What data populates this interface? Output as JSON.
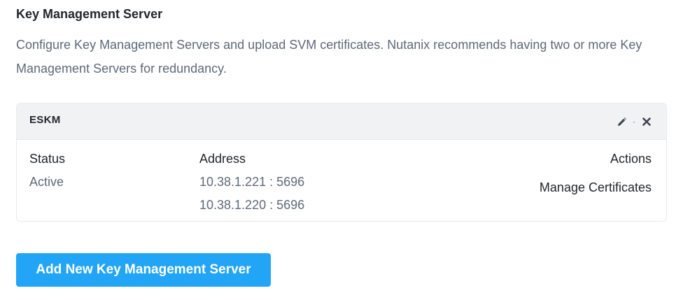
{
  "section": {
    "title": "Key Management Server",
    "description": "Configure Key Management Servers and upload SVM certificates. Nutanix recommends having two or more Key Management Servers for redundancy."
  },
  "server_card": {
    "name": "ESKM",
    "header_icons": [
      "pencil-icon",
      "close-icon"
    ],
    "separator": "·",
    "columns": {
      "status_label": "Status",
      "address_label": "Address",
      "actions_label": "Actions"
    },
    "status": "Active",
    "addresses": [
      "10.38.1.221 : 5696",
      "10.38.1.220 : 5696"
    ],
    "manage_label": "Manage Certificates"
  },
  "add_button": {
    "label": "Add New Key Management Server"
  },
  "colors": {
    "primary": "#22a5f7",
    "text_dark": "#22272e",
    "text_muted": "#5d6a7b",
    "header_bg": "#f1f2f4"
  }
}
